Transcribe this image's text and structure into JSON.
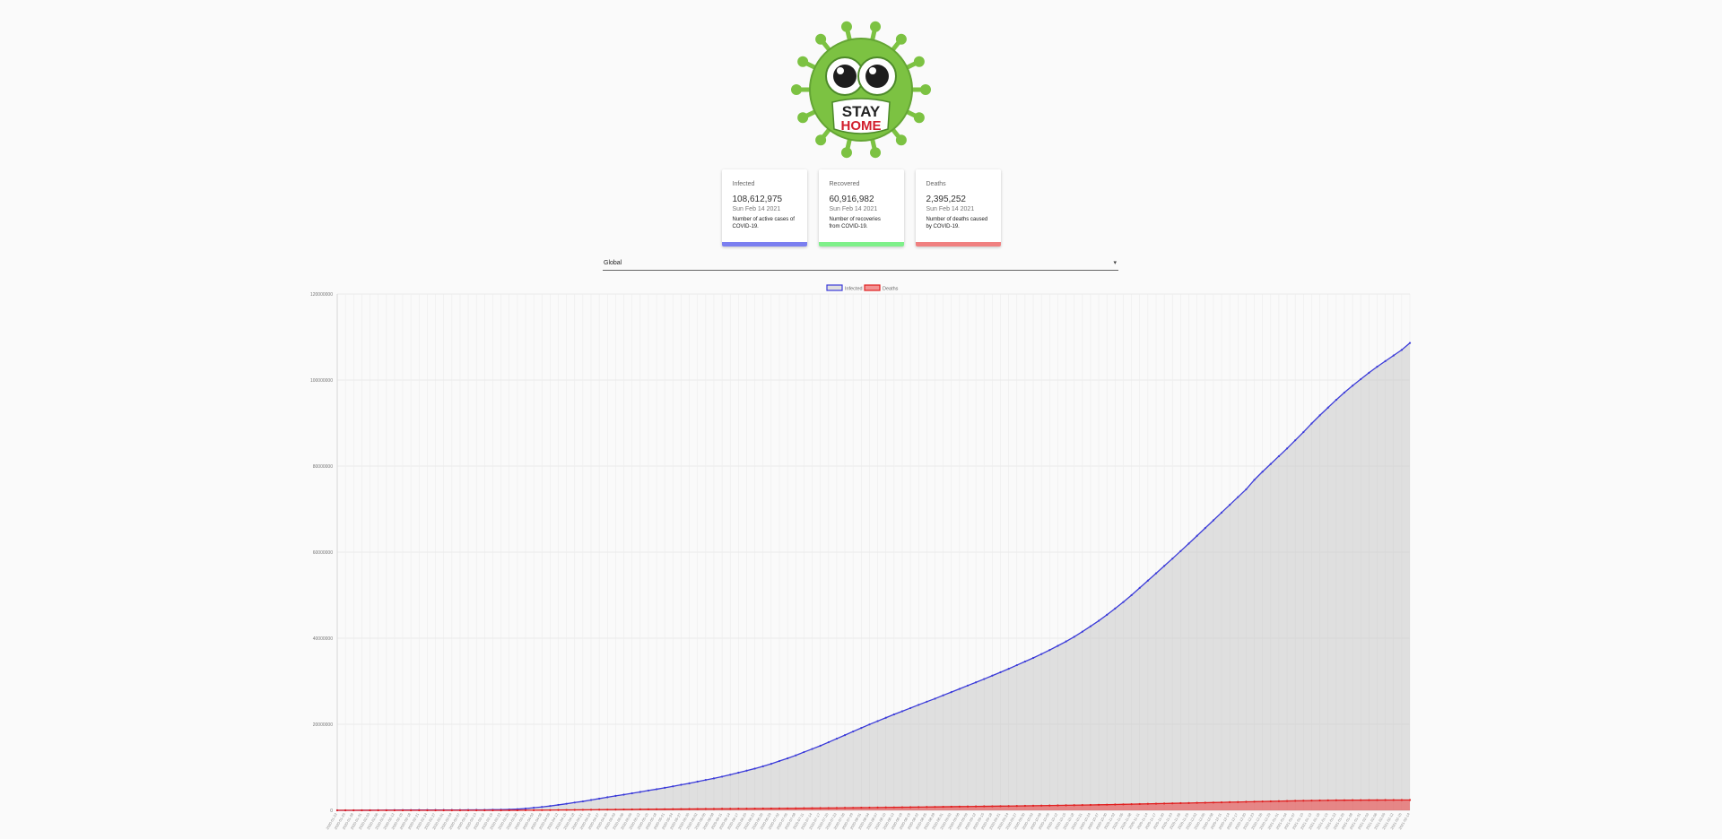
{
  "logo": {
    "alt": "virus mascot",
    "text_line1": "STAY",
    "text_line2": "HOME"
  },
  "cards": [
    {
      "title": "Infected",
      "value": "108,612,975",
      "date": "Sun Feb 14 2021",
      "description": "Number of active cases of COVID-19.",
      "color": "#7b7ff0"
    },
    {
      "title": "Recovered",
      "value": "60,916,982",
      "date": "Sun Feb 14 2021",
      "description": "Number of recoveries from COVID-19.",
      "color": "#7ff08a"
    },
    {
      "title": "Deaths",
      "value": "2,395,252",
      "date": "Sun Feb 14 2021",
      "description": "Number of deaths caused by COVID-19.",
      "color": "#f08080"
    }
  ],
  "region_select": {
    "value": "Global"
  },
  "chart_data": {
    "type": "line",
    "legend": [
      "Infected",
      "Deaths"
    ],
    "legend_position": "top-center",
    "grid": true,
    "ylim": [
      0,
      120000000
    ],
    "yticks": [
      0,
      20000000,
      40000000,
      60000000,
      80000000,
      100000000,
      120000000
    ],
    "x_start": "2020-01-22",
    "x_end": "2021-02-14",
    "x_step_days": 3,
    "series": [
      {
        "name": "Infected",
        "color": "#3b3bd9",
        "fill": "rgba(190,190,190,0.45)",
        "values": [
          555,
          2118,
          6166,
          9927,
          14553,
          23900,
          36000,
          45300,
          62000,
          65200,
          72800,
          77600,
          78900,
          80400,
          81500,
          83000,
          88400,
          98000,
          105800,
          145000,
          156000,
          197000,
          272000,
          420000,
          600000,
          788000,
          1000000,
          1267000,
          1528000,
          1814000,
          2071000,
          2405000,
          2720000,
          3040000,
          3352000,
          3645000,
          3960000,
          4270000,
          4600000,
          4910000,
          5240000,
          5580000,
          5930000,
          6280000,
          6660000,
          7050000,
          7420000,
          7830000,
          8270000,
          8750000,
          9220000,
          9700000,
          10230000,
          10800000,
          11450000,
          12080000,
          12770000,
          13530000,
          14260000,
          15000000,
          15820000,
          16650000,
          17480000,
          18320000,
          19140000,
          19960000,
          20740000,
          21510000,
          22290000,
          23030000,
          23760000,
          24520000,
          25250000,
          25950000,
          26730000,
          27470000,
          28220000,
          29000000,
          29740000,
          30510000,
          31300000,
          32080000,
          32890000,
          33740000,
          34580000,
          35420000,
          36310000,
          37250000,
          38230000,
          39240000,
          40330000,
          41520000,
          42770000,
          44050000,
          45450000,
          46900000,
          48400000,
          50000000,
          51700000,
          53380000,
          55080000,
          56800000,
          58500000,
          60250000,
          62000000,
          63800000,
          65600000,
          67400000,
          69200000,
          71000000,
          72800000,
          74600000,
          76800000,
          78700000,
          80500000,
          82300000,
          84100000,
          86000000,
          87900000,
          89900000,
          91800000,
          93600000,
          95400000,
          97100000,
          98700000,
          100200000,
          101700000,
          103100000,
          104400000,
          105700000,
          107000000,
          108612975
        ]
      },
      {
        "name": "Deaths",
        "color": "#e02020",
        "fill": "rgba(235,60,60,0.55)",
        "values": [
          17,
          56,
          133,
          213,
          305,
          490,
          724,
          908,
          1110,
          1380,
          1770,
          2120,
          2360,
          2620,
          2760,
          2870,
          3050,
          3340,
          3560,
          5300,
          6500,
          8700,
          12900,
          19700,
          28500,
          40700,
          58800,
          74600,
          88500,
          103000,
          119500,
          135500,
          152000,
          168000,
          182000,
          197000,
          213000,
          228000,
          245000,
          260000,
          275000,
          287000,
          297000,
          310000,
          321000,
          333000,
          345000,
          359000,
          371000,
          384000,
          397000,
          407000,
          419000,
          431000,
          445000,
          460000,
          474000,
          490000,
          505000,
          520000,
          536000,
          553000,
          570000,
          589000,
          610000,
          630000,
          650000,
          672000,
          693000,
          715000,
          735000,
          752000,
          775000,
          798000,
          820000,
          845000,
          868000,
          889000,
          910000,
          930000,
          952000,
          974000,
          996000,
          1020000,
          1044000,
          1068000,
          1092000,
          1118000,
          1142000,
          1168000,
          1196000,
          1224000,
          1253000,
          1285000,
          1318000,
          1354000,
          1392000,
          1430000,
          1468000,
          1506000,
          1545000,
          1584000,
          1623000,
          1661000,
          1700000,
          1738000,
          1776000,
          1815000,
          1856000,
          1894000,
          1933000,
          1972000,
          2014000,
          2054000,
          2095000,
          2135000,
          2172000,
          2206000,
          2240000,
          2270000,
          2297000,
          2320000,
          2340000,
          2355000,
          2365000,
          2373000,
          2380000,
          2385000,
          2389000,
          2391000,
          2393000,
          2395252
        ]
      }
    ]
  }
}
